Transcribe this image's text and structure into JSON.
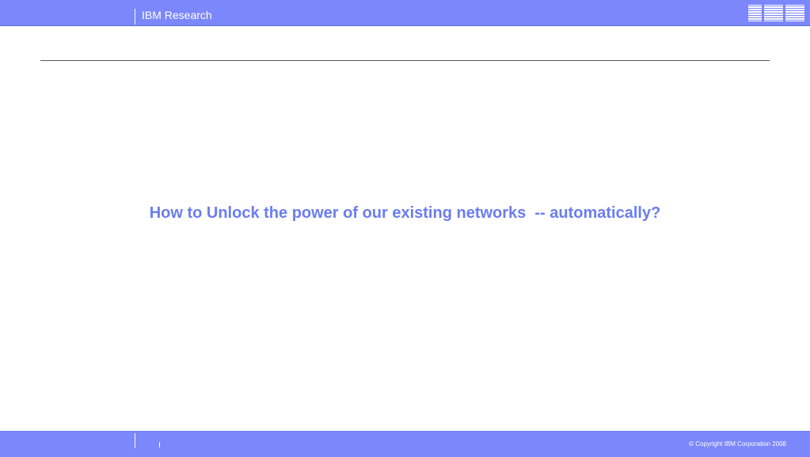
{
  "header": {
    "title": "IBM Research",
    "logo": {
      "text": "IBM",
      "icon": "ibm-logo",
      "stripe_color": "#ffffff"
    },
    "background_color": "#7b87fb"
  },
  "slide": {
    "heading": "How to Unlock the power of our existing networks  -- automatically?",
    "heading_color": "#6b7df0",
    "rule_color": "#5a5a5a"
  },
  "footer": {
    "copyright": "© Copyright IBM Corporation 2008",
    "background_color": "#7b87fb"
  }
}
